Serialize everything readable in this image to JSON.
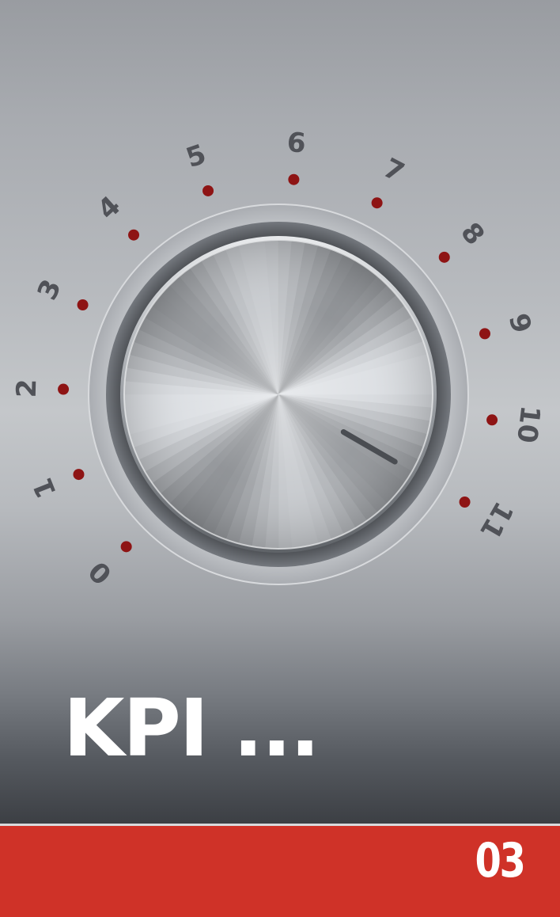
{
  "dial": {
    "labels": [
      "0",
      "1",
      "2",
      "3",
      "4",
      "5",
      "6",
      "7",
      "8",
      "9",
      "10",
      "11"
    ],
    "dot_color": "#8e1414",
    "value": 11
  },
  "title": "KPI ...",
  "footer": {
    "page_number": "03",
    "background_color": "#cf3228"
  }
}
